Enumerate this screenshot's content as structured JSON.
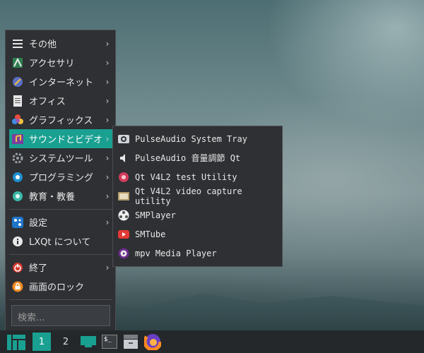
{
  "menu": {
    "items": [
      {
        "label": "その他",
        "icon": "list-icon"
      },
      {
        "label": "アクセサリ",
        "icon": "accessories-icon"
      },
      {
        "label": "インターネット",
        "icon": "internet-icon"
      },
      {
        "label": "オフィス",
        "icon": "office-icon"
      },
      {
        "label": "グラフィックス",
        "icon": "graphics-icon"
      },
      {
        "label": "サウンドとビデオ",
        "icon": "multimedia-icon"
      },
      {
        "label": "システムツール",
        "icon": "system-tools-icon"
      },
      {
        "label": "プログラミング",
        "icon": "programming-icon"
      },
      {
        "label": "教育・教養",
        "icon": "education-icon"
      }
    ],
    "settings_label": "設定",
    "about_label": "LXQt について",
    "leave_label": "終了",
    "lock_label": "画面のロック",
    "arrow": "›",
    "search_placeholder": "検索..."
  },
  "submenu": {
    "items": [
      {
        "label": "PulseAudio System Tray",
        "icon": "pulseaudio-tray-icon"
      },
      {
        "label": "PulseAudio 音量調節 Qt",
        "icon": "speaker-icon"
      },
      {
        "label": "Qt V4L2 test Utility",
        "icon": "qv4l2-icon"
      },
      {
        "label": "Qt V4L2 video capture utility",
        "icon": "video-capture-icon"
      },
      {
        "label": "SMPlayer",
        "icon": "smplayer-icon"
      },
      {
        "label": "SMTube",
        "icon": "smtube-icon"
      },
      {
        "label": "mpv Media Player",
        "icon": "mpv-icon"
      }
    ]
  },
  "taskbar": {
    "workspace_1": "1",
    "workspace_2": "2",
    "terminal_glyph": "$_"
  },
  "colors": {
    "accent": "#19a091",
    "menu_bg": "#2e3033",
    "taskbar_bg": "#24282b"
  }
}
